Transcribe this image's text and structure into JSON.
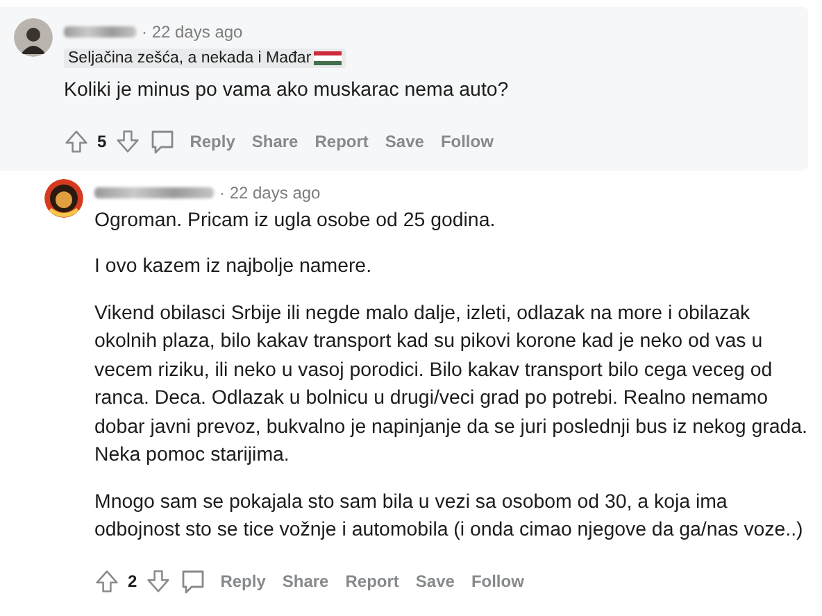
{
  "comments": [
    {
      "author_blurred": true,
      "time": "· 22 days ago",
      "flair": "Seljačina zešća, a nekada i Mađar",
      "kind": "parent",
      "paragraphs": [
        "Koliki je minus po vama ako muskarac nema auto?"
      ],
      "score": "5",
      "actions": [
        "Reply",
        "Share",
        "Report",
        "Save",
        "Follow"
      ]
    },
    {
      "author_blurred": true,
      "time": "· 22 days ago",
      "kind": "reply",
      "paragraphs": [
        "Ogroman. Pricam iz ugla osobe od 25 godina.",
        "I ovo kazem iz najbolje namere.",
        "Vikend obilasci Srbije ili negde malo dalje, izleti, odlazak na more i obilazak okolnih plaza, bilo kakav transport kad su pikovi korone kad je neko od vas u vecem riziku, ili neko u vasoj porodici. Bilo kakav transport bilo cega veceg od ranca. Deca. Odlazak u bolnicu u drugi/veci grad po potrebi. Realno nemamo dobar javni prevoz, bukvalno je napinjanje da se juri poslednji bus iz nekog grada. Neka pomoc starijima.",
        "Mnogo sam se pokajala sto sam bila u vezi sa osobom od 30, a koja ima odbojnost sto se tice vožnje i automobila (i onda cimao njegove da ga/nas voze..)"
      ],
      "score": "2",
      "actions": [
        "Reply",
        "Share",
        "Report",
        "Save",
        "Follow"
      ]
    }
  ]
}
